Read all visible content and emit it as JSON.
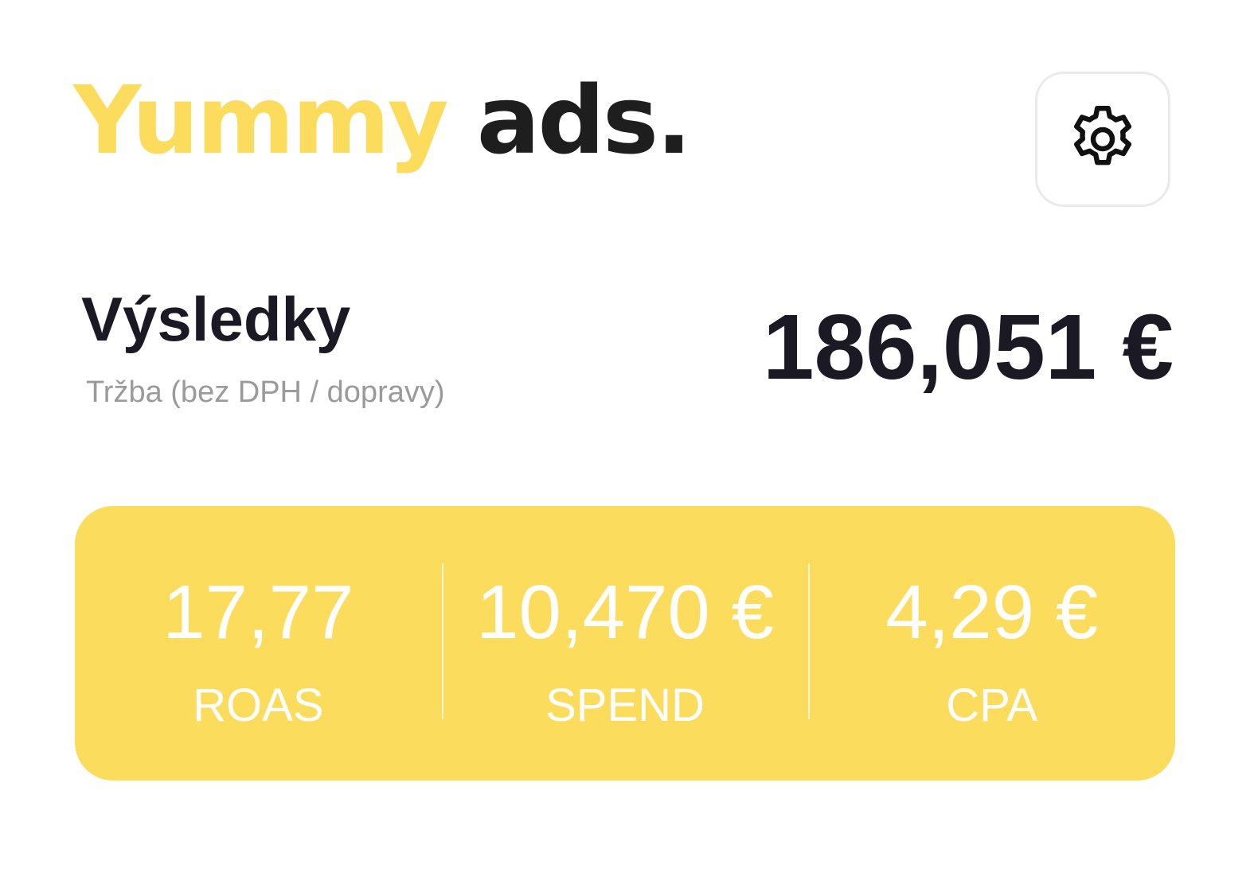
{
  "header": {
    "logo": {
      "part1": "Yummy",
      "part2": "ads.",
      "color_part1": "#fbdc5d",
      "color_part2": "#1e1e1e"
    },
    "settings_icon": "gear-icon"
  },
  "results": {
    "title": "Výsledky",
    "subtitle": "Tržba (bez DPH / dopravy)",
    "value": "186,051 €"
  },
  "metrics": {
    "background_color": "#fbdc5d",
    "items": [
      {
        "value": "17,77",
        "label": "ROAS"
      },
      {
        "value": "10,470 €",
        "label": "SPEND"
      },
      {
        "value": "4,29 €",
        "label": "CPA"
      }
    ]
  }
}
